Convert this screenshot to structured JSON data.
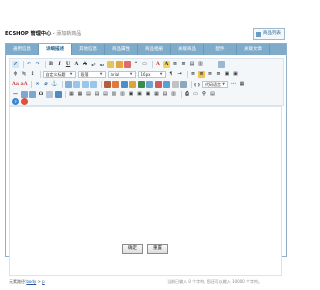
{
  "header": {
    "app_title": "ECSHOP 管理中心",
    "separator": " - ",
    "page_title": "添加新商品",
    "list_button": "商品列表"
  },
  "tabs": [
    {
      "label": "通用信息",
      "active": false
    },
    {
      "label": "详细描述",
      "active": true
    },
    {
      "label": "其他信息",
      "active": false
    },
    {
      "label": "商品属性",
      "active": false
    },
    {
      "label": "商品相册",
      "active": false
    },
    {
      "label": "关联商品",
      "active": false
    },
    {
      "label": "配件",
      "active": false
    },
    {
      "label": "关联文章",
      "active": false
    }
  ],
  "toolbar": {
    "format_combo": "自定义标题",
    "paragraph_combo": "段落",
    "font_combo": "arial",
    "size_combo": "16px",
    "code_combo": "代码语言"
  },
  "editor": {
    "path_label": "元素路径:",
    "path_body": "body",
    "path_sep": " > ",
    "path_p": "p",
    "word_count": "当前已输入 0 个字符, 您还可以输入 10000 个字符。"
  },
  "actions": {
    "ok_label": "确定",
    "reset_label": "重置"
  }
}
